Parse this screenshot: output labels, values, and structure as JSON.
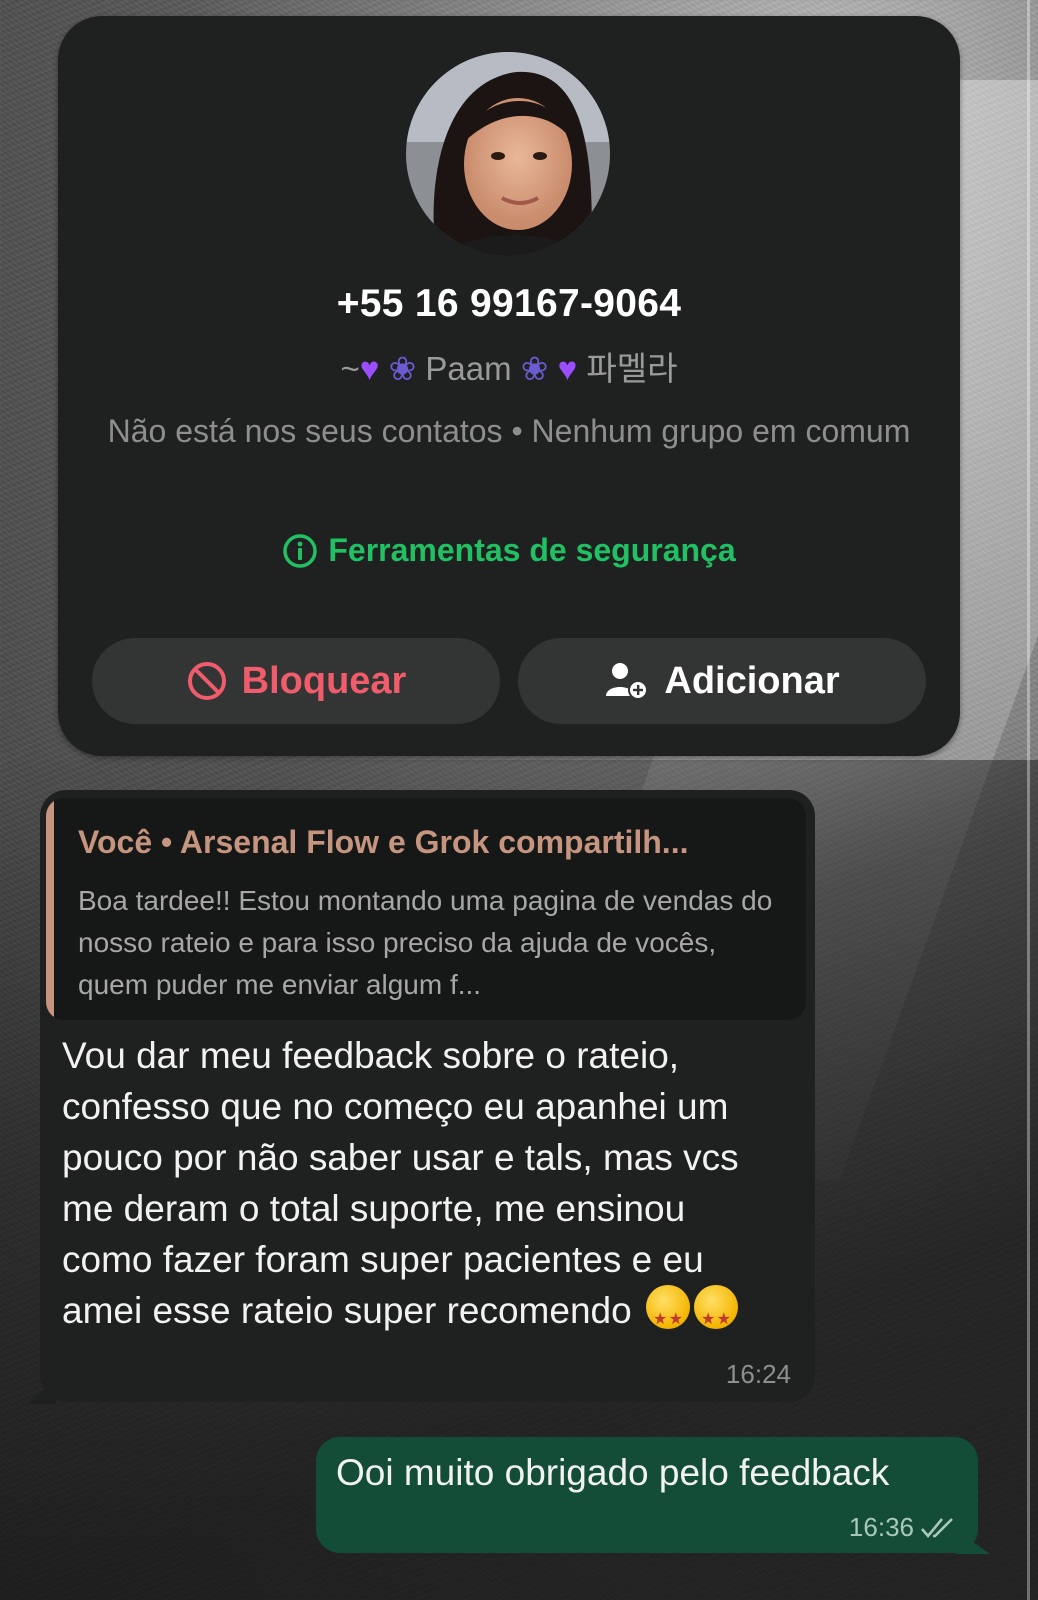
{
  "contact": {
    "phone": "+55 16 99167-9064",
    "push_name": "Paam",
    "push_name_korean": "파멜라",
    "meta": "Não está nos seus contatos • Nenhum grupo em comum",
    "safety_tools": "Ferramentas de segurança",
    "block_label": "Bloquear",
    "add_label": "Adicionar"
  },
  "incoming_message": {
    "quote_author": "Você • Arsenal Flow e Grok compartilh...",
    "quote_text": "Boa tardee!! Estou montando uma pagina de vendas do nosso rateio e para isso preciso da ajuda de vocês, quem puder me enviar algum f...",
    "body": "Vou dar meu feedback sobre o rateio, confesso que no começo eu apanhei um pouco por não saber usar e tals, mas vcs me deram o total suporte, me ensinou como fazer foram super pacientes e eu amei esse rateio super recomendo",
    "time": "16:24"
  },
  "outgoing_message": {
    "body": "Ooi muito obrigado pelo feedback",
    "time": "16:36"
  },
  "colors": {
    "card_bg": "#1f2121",
    "safety_green": "#21c063",
    "block_red": "#f15c6d",
    "quote_accent": "#c6957f",
    "outgoing_bubble": "#144d37"
  }
}
